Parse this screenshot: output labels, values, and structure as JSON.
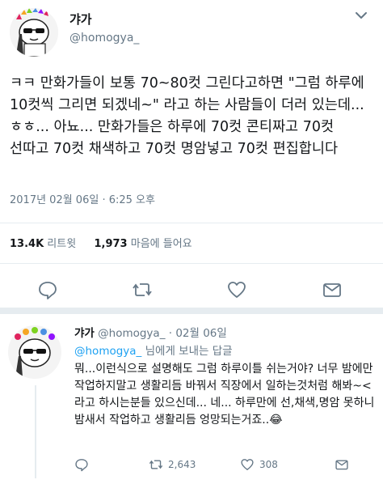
{
  "tweet": {
    "author_name": "갸가",
    "author_handle": "@homogya_",
    "text": "ㅋㅋ 만화가들이 보통 70~80컷 그린다고하면 \"그럼 하루에 10컷씩 그리면 되겠네~\" 라고 하는 사람들이 더러 있는데...ㅎㅎ... 아뇨... 만화가들은 하루에 70컷 콘티짜고 70컷 선따고 70컷 채색하고 70컷 명암넣고 70컷 편집합니다",
    "timestamp": "2017년 02월 06일 · 6:25 오후",
    "retweets_count": "13.4K",
    "retweets_label": "리트윗",
    "likes_count": "1,973",
    "likes_label": "마음에 들어요"
  },
  "actions": {
    "icons": [
      "reply-icon",
      "retweet-icon",
      "like-icon",
      "share-icon"
    ]
  },
  "reply": {
    "author_name": "갸가",
    "author_handle": "@homogya_",
    "date": "· 02월 06일",
    "replying_mention": "@homogya_",
    "replying_suffix": "님에게 보내는 답글",
    "text": "뭐...이런식으로 설명해도 그럼 하루이틀 쉬는거야? 너무 밤에만 작업하지말고 생활리듬 바꿔서 직장에서 일하는것처럼 해봐~<라고 하시는분들 있으신데... 네... 하루만에 선,채색,명암 못하니 밤새서 작업하고 생활리듬 엉망되는거죠..😂",
    "reply_count": "",
    "retweet_count": "2,643",
    "like_count": "308"
  },
  "colors": {
    "accent": "#1da1f2",
    "text": "#14171a",
    "muted": "#657786",
    "divider": "#e6ecf0"
  }
}
